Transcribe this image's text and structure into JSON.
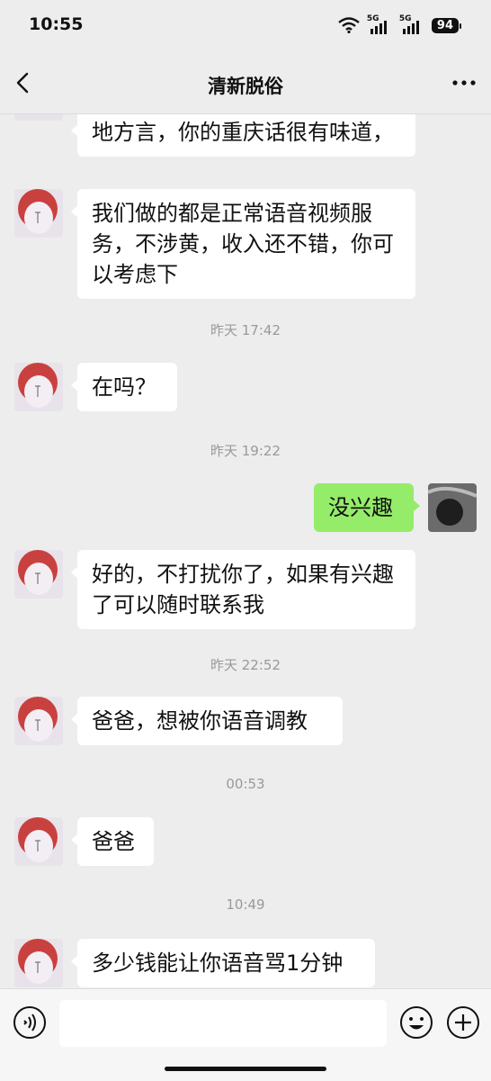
{
  "status_bar": {
    "time": "10:55",
    "network1": "5G",
    "network2": "5G",
    "battery": "94"
  },
  "header": {
    "title": "清新脱俗"
  },
  "messages": [
    {
      "side": "left",
      "text": "地方言，你的重庆话很有味道，"
    },
    {
      "side": "left",
      "text": "我们做的都是正常语音视频服务，不涉黄，收入还不错，你可以考虑下"
    },
    {
      "timestamp": "昨天 17:42"
    },
    {
      "side": "left",
      "text": "在吗？"
    },
    {
      "timestamp": "昨天 19:22"
    },
    {
      "side": "right",
      "text": "没兴趣"
    },
    {
      "side": "left",
      "text": "好的，不打扰你了，如果有兴趣了可以随时联系我"
    },
    {
      "timestamp": "昨天 22:52"
    },
    {
      "side": "left",
      "text": "爸爸，想被你语音调教"
    },
    {
      "timestamp": "00:53"
    },
    {
      "side": "left",
      "text": "爸爸"
    },
    {
      "timestamp": "10:49"
    },
    {
      "side": "left",
      "text": "多少钱能让你语音骂1分钟"
    }
  ],
  "input": {
    "value": ""
  },
  "colors": {
    "background": "#ededed",
    "sent_bubble": "#95ec69",
    "received_bubble": "#ffffff"
  }
}
